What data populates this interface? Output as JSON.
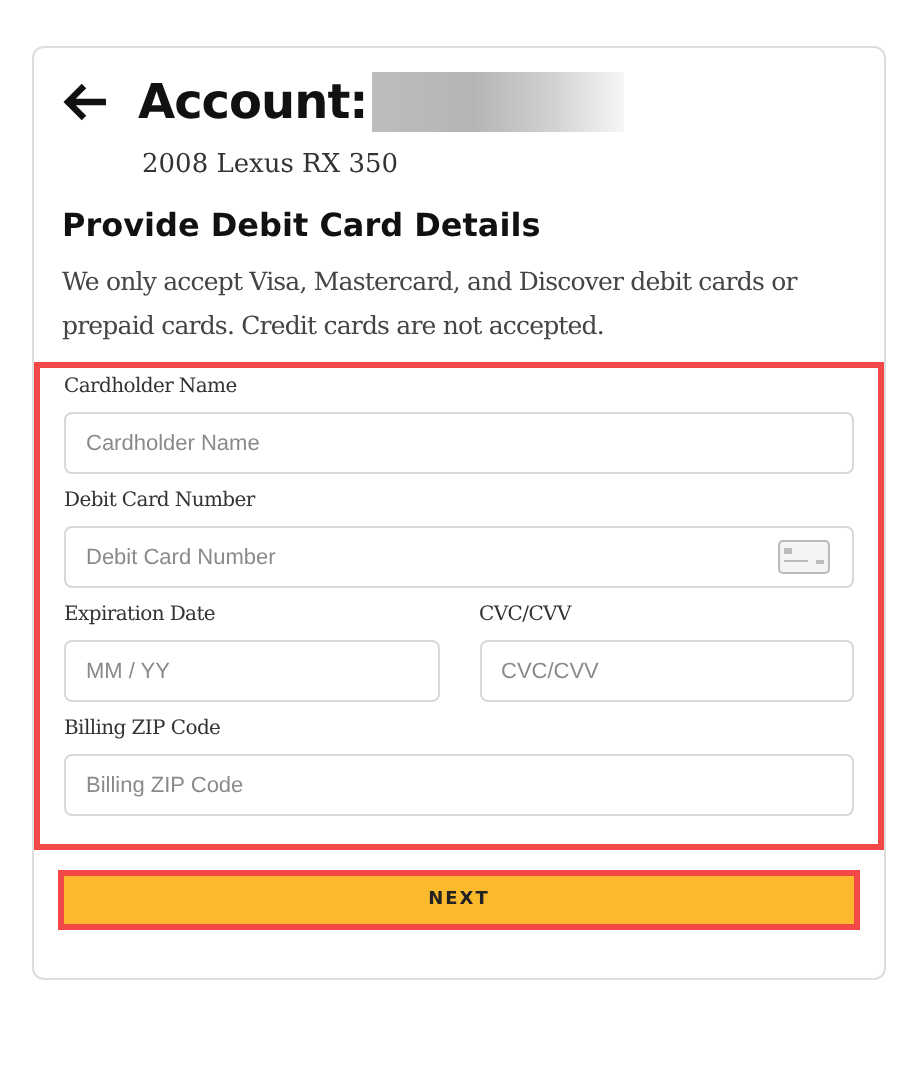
{
  "header": {
    "title": "Account:",
    "vehicle": "2008 Lexus RX 350"
  },
  "section": {
    "heading": "Provide Debit Card Details",
    "notice": "We only accept Visa, Mastercard, and Discover debit cards or prepaid cards. Credit cards are not accepted."
  },
  "form": {
    "highlighted": true,
    "rows": [
      [
        {
          "label": "Cardholder Name",
          "placeholder": "Cardholder Name",
          "kind": "text"
        }
      ],
      [
        {
          "label": "Debit Card Number",
          "placeholder": "Debit Card Number",
          "kind": "card"
        }
      ],
      [
        {
          "label": "Expiration Date",
          "placeholder": "MM / YY",
          "kind": "text"
        },
        {
          "label": "CVC/CVV",
          "placeholder": "CVC/CVV",
          "kind": "text"
        }
      ],
      [
        {
          "label": "Billing ZIP Code",
          "placeholder": "Billing ZIP Code",
          "kind": "text"
        }
      ]
    ]
  },
  "next_button": {
    "label": "NEXT",
    "highlighted": true
  }
}
